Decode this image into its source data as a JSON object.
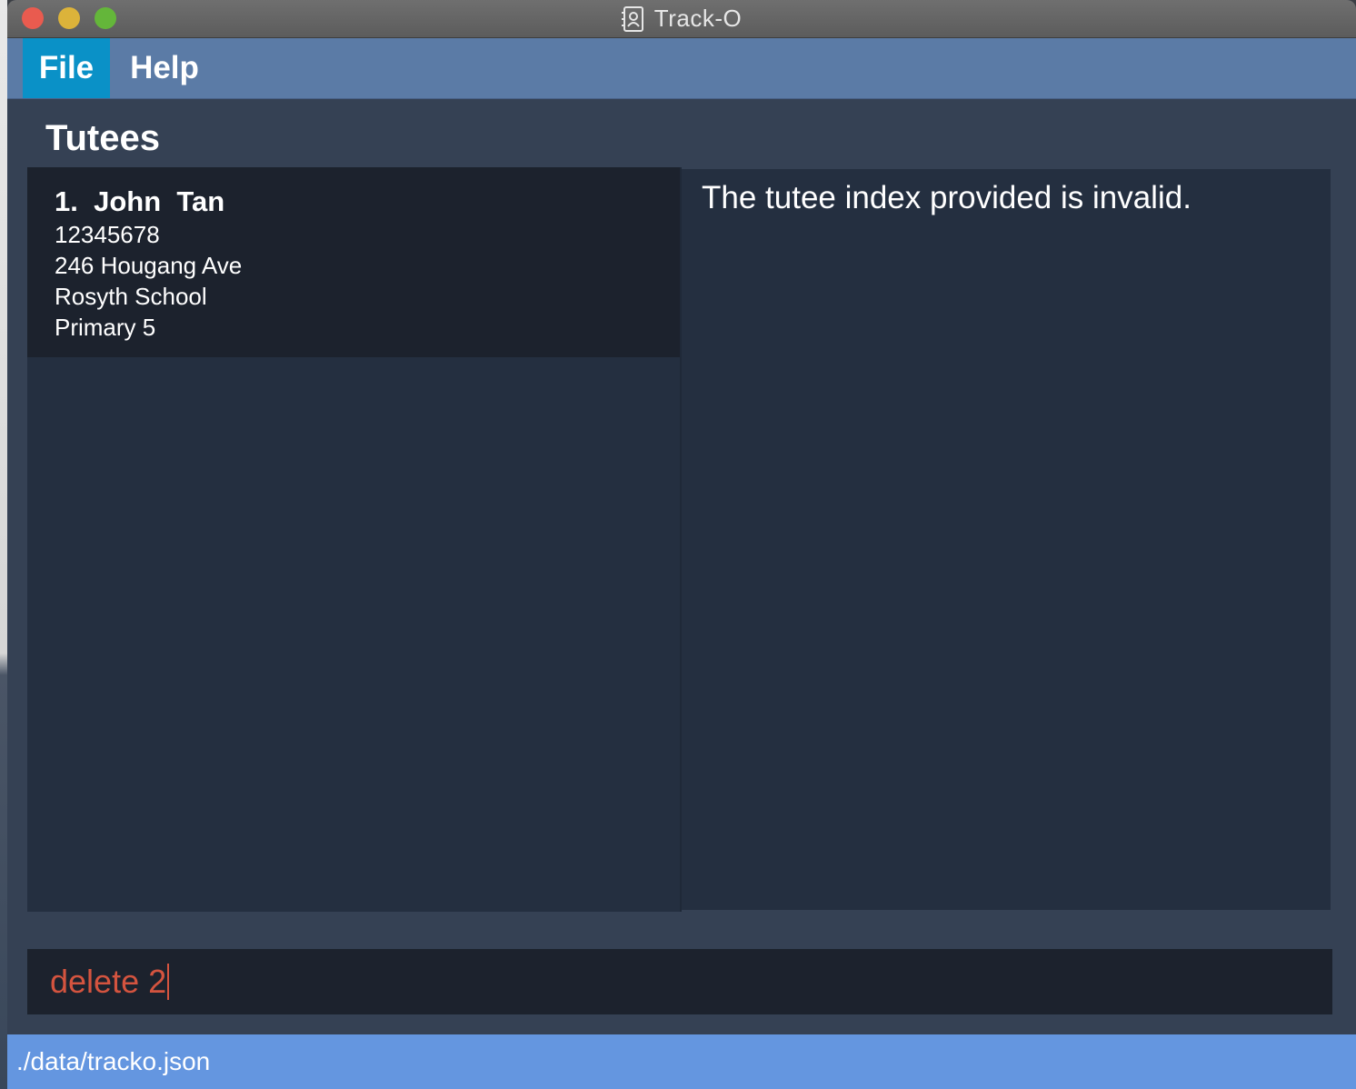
{
  "window": {
    "title": "Track-O",
    "app_icon": "contacts-book-icon"
  },
  "menu": {
    "file_label": "File",
    "help_label": "Help"
  },
  "tutees": {
    "heading": "Tutees",
    "items": [
      {
        "name": "1.  John  Tan",
        "phone": "12345678",
        "address": "246 Hougang Ave",
        "school": "Rosyth School",
        "level": "Primary 5"
      }
    ]
  },
  "result": {
    "message": "The tutee index provided is invalid."
  },
  "command": {
    "value": "delete 2",
    "text_color": "#d4543f"
  },
  "status": {
    "path": "./data/tracko.json"
  },
  "colors": {
    "menu_bar": "#5b7ba6",
    "menu_selected": "#0a91c7",
    "panel": "#242f40",
    "card": "#1c222d",
    "status_bar": "#6496e0"
  }
}
